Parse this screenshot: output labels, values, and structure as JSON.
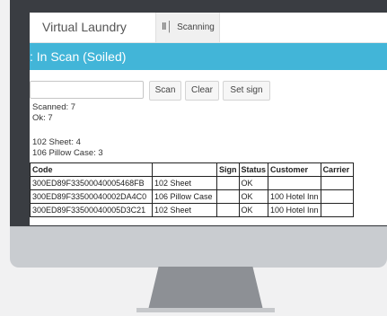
{
  "tabs": {
    "home_label": "Virtual Laundry",
    "scan_icon": "barcode-icon",
    "scan_label": "Scanning"
  },
  "header": {
    "title": ": In Scan (Soiled)"
  },
  "controls": {
    "input_value": "",
    "scan_label": "Scan",
    "clear_label": "Clear",
    "set_sign_label": "Set sign"
  },
  "summary": {
    "scanned": "Scanned: 7",
    "ok": "Ok: 7",
    "counts": [
      "102 Sheet: 4",
      "106 Pillow Case: 3"
    ]
  },
  "table": {
    "columns": [
      "Code",
      "",
      "Sign",
      "Status",
      "Customer",
      "Carrier"
    ],
    "rows": [
      [
        "300ED89F33500040005468FB",
        "102 Sheet",
        "",
        "OK",
        "",
        ""
      ],
      [
        "300ED89F33500040002DA4C0",
        "106 Pillow Case",
        "",
        "OK",
        "100 Hotel Inn",
        ""
      ],
      [
        "300ED89F33500040005D3C21",
        "102 Sheet",
        "",
        "OK",
        "100 Hotel Inn",
        ""
      ]
    ]
  },
  "colors": {
    "header_bg": "#42b5d8",
    "bezel": "#3a3d42",
    "chin": "#c9ccd0",
    "stand": "#8d9095"
  }
}
